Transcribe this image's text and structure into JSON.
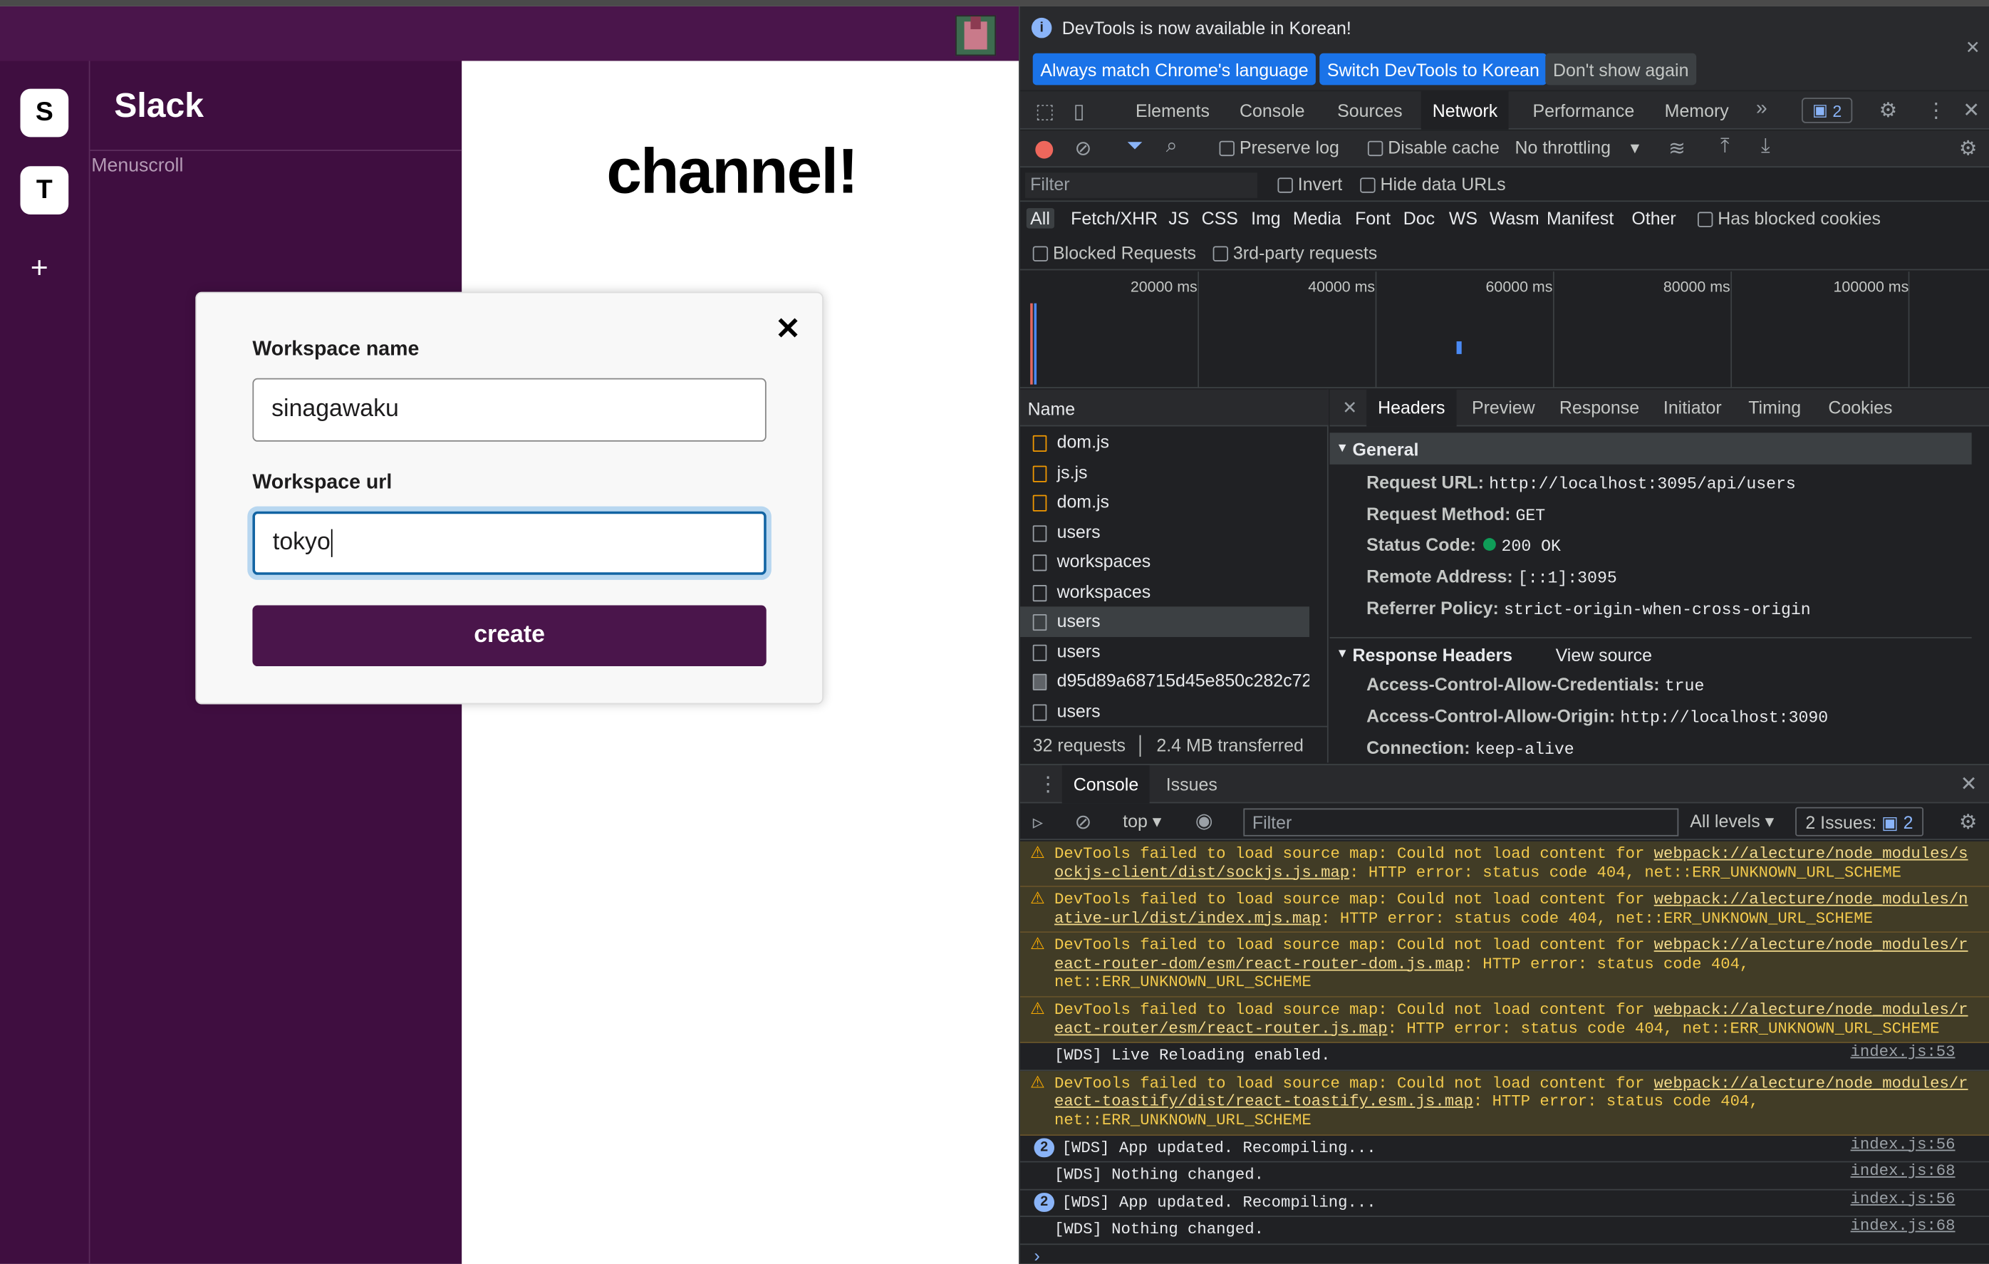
{
  "app": {
    "workspaces": [
      "S",
      "T"
    ],
    "add_label": "+",
    "workspace_title": "Slack",
    "menu_text": "Menuscroll",
    "channel_heading": "channel!"
  },
  "modal": {
    "close": "✕",
    "name_label": "Workspace name",
    "name_value": "sinagawaku",
    "url_label": "Workspace url",
    "url_value": "tokyo",
    "create_label": "create"
  },
  "devtools": {
    "info_message": "DevTools is now available in Korean!",
    "btn_match": "Always match Chrome's language",
    "btn_switch": "Switch DevTools to Korean",
    "btn_dismiss": "Don't show again",
    "tabs": [
      "Elements",
      "Console",
      "Sources",
      "Network",
      "Performance",
      "Memory"
    ],
    "active_tab": "Network",
    "issues_badge": "2",
    "network": {
      "preserve_log": "Preserve log",
      "disable_cache": "Disable cache",
      "throttling": "No throttling",
      "filter_placeholder": "Filter",
      "invert": "Invert",
      "hide_data_urls": "Hide data URLs",
      "types": [
        "All",
        "Fetch/XHR",
        "JS",
        "CSS",
        "Img",
        "Media",
        "Font",
        "Doc",
        "WS",
        "Wasm",
        "Manifest",
        "Other"
      ],
      "has_blocked_cookies": "Has blocked cookies",
      "blocked_requests": "Blocked Requests",
      "third_party": "3rd-party requests",
      "timeline_labels": [
        "20000 ms",
        "40000 ms",
        "60000 ms",
        "80000 ms",
        "100000 ms"
      ],
      "name_header": "Name",
      "requests": [
        "dom.js",
        "js.js",
        "dom.js",
        "users",
        "workspaces",
        "workspaces",
        "users",
        "users",
        "d95d89a68715d45e850c282c72...",
        "users"
      ],
      "footer_requests": "32 requests",
      "footer_transferred": "2.4 MB transferred"
    },
    "headers": {
      "tabs": [
        "Headers",
        "Preview",
        "Response",
        "Initiator",
        "Timing",
        "Cookies"
      ],
      "general_title": "General",
      "general": [
        {
          "k": "Request URL:",
          "v": "http://localhost:3095/api/users"
        },
        {
          "k": "Request Method:",
          "v": "GET"
        },
        {
          "k": "Status Code:",
          "v": "200 OK"
        },
        {
          "k": "Remote Address:",
          "v": "[::1]:3095"
        },
        {
          "k": "Referrer Policy:",
          "v": "strict-origin-when-cross-origin"
        }
      ],
      "response_title": "Response Headers",
      "view_source": "View source",
      "response": [
        {
          "k": "Access-Control-Allow-Credentials:",
          "v": "true"
        },
        {
          "k": "Access-Control-Allow-Origin:",
          "v": "http://localhost:3090"
        },
        {
          "k": "Connection:",
          "v": "keep-alive"
        }
      ]
    },
    "console": {
      "tab_console": "Console",
      "tab_issues": "Issues",
      "context": "top",
      "filter_placeholder": "Filter",
      "levels": "All levels",
      "issues": "2 Issues:",
      "issues_count": "2",
      "messages": [
        {
          "pre": "DevTools failed to load source map: Could not load content for ",
          "url": "webpack://alecture/node_modules/s",
          "url2": "ockjs-client/dist/sockjs.js.map",
          "post": ": HTTP error: status code 404, net::ERR_UNKNOWN_URL_SCHEME"
        },
        {
          "pre": "DevTools failed to load source map: Could not load content for ",
          "url": "webpack://alecture/node_modules/n",
          "url2": "ative-url/dist/index.mjs.map",
          "post": ": HTTP error: status code 404, net::ERR_UNKNOWN_URL_SCHEME"
        },
        {
          "pre": "DevTools failed to load source map: Could not load content for ",
          "url": "webpack://alecture/node_modules/r",
          "url2": "eact-router-dom/esm/react-router-dom.js.map",
          "post": ": HTTP error: status code 404,",
          "post2": "net::ERR_UNKNOWN_URL_SCHEME"
        },
        {
          "pre": "DevTools failed to load source map: Could not load content for ",
          "url": "webpack://alecture/node_modules/r",
          "url2": "eact-router/esm/react-router.js.map",
          "post": ": HTTP error: status code 404, net::ERR_UNKNOWN_URL_SCHEME"
        },
        {
          "text": "[WDS] Live Reloading enabled.",
          "src": "index.js:53"
        },
        {
          "pre": "DevTools failed to load source map: Could not load content for ",
          "url": "webpack://alecture/node_modules/r",
          "url2": "eact-toastify/dist/react-toastify.esm.js.map",
          "post": ": HTTP error: status code 404,",
          "post2": "net::ERR_UNKNOWN_URL_SCHEME"
        },
        {
          "count": "2",
          "text": "[WDS] App updated. Recompiling...",
          "src": "index.js:56"
        },
        {
          "text": "[WDS] Nothing changed.",
          "src": "index.js:68"
        },
        {
          "count": "2",
          "text": "[WDS] App updated. Recompiling...",
          "src": "index.js:56"
        },
        {
          "text": "[WDS] Nothing changed.",
          "src": "index.js:68"
        }
      ],
      "prompt": "›"
    }
  }
}
